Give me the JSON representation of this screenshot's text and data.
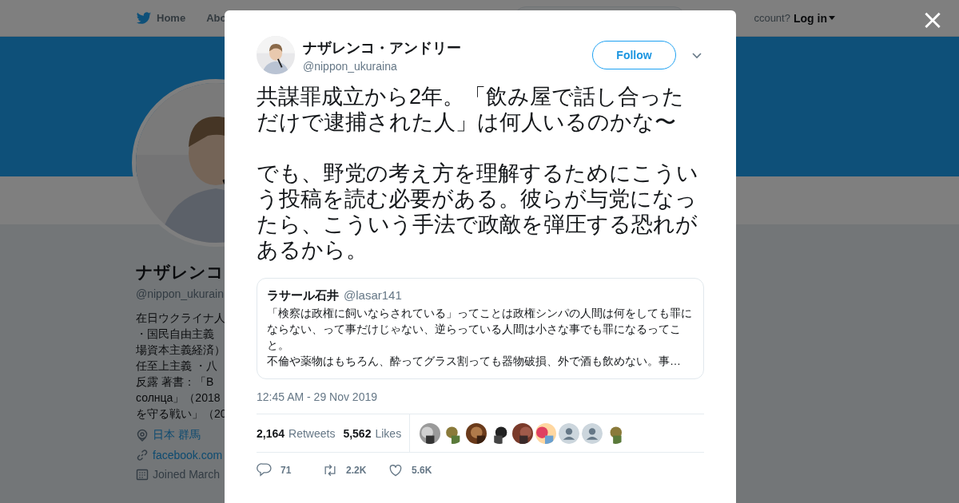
{
  "background_page": {
    "nav": {
      "items": [
        {
          "kind": "home",
          "label": "Home"
        },
        {
          "kind": "text",
          "label": "Abo"
        }
      ],
      "account_prompt": "ccount?",
      "login": "Log in"
    },
    "profile": {
      "avatar": {
        "kind": "picture"
      },
      "name": "ナザレンコ",
      "handle": "@nippon_ukurain",
      "bio_lines": [
        "在日ウクライナ人",
        "・国民自由主義",
        "場資本主義経済）",
        "任至上主義 ・八",
        "反露 著書：「В",
        "солнца」（2018",
        "を守る戦い」（20"
      ],
      "details": [
        {
          "kind": "location",
          "text": "日本 群馬"
        },
        {
          "kind": "link",
          "text": "facebook.com"
        },
        {
          "kind": "joined",
          "text": "Joined March"
        }
      ]
    }
  },
  "close_label": "×",
  "tweet": {
    "author": {
      "avatar": {
        "kind": "picture"
      },
      "name": "ナザレンコ・アンドリー",
      "handle": "@nippon_ukuraina"
    },
    "follow_button": "Follow",
    "paragraphs": [
      "共謀罪成立から2年。「飲み屋で話し合っただけで逮捕された人」は何人いるのかな〜",
      "でも、野党の考え方を理解するためにこういう投稿を読む必要がある。彼らが与党になったら、こういう手法で政敵を弾圧する恐れがあるから。"
    ],
    "quoted_tweet": {
      "name": "ラサール石井",
      "handle": "@lasar141",
      "lines": [
        "「検察は政権に飼いならされている」ってことは政権シンパの人間は何をしても罪にならない、って事だけじゃない、逆らっている人間は小さな事でも罪になるってこと。",
        "不倫や薬物はもちろん、酔ってグラス割っても器物破損、外で酒も飲めない。事…"
      ]
    },
    "timestamp": "12:45 AM - 29 Nov 2019",
    "stats": [
      {
        "count": "2,164",
        "label": "Retweets"
      },
      {
        "count": "5,562",
        "label": "Likes"
      }
    ],
    "liker_avatars": [
      {
        "kind": "picture"
      },
      {
        "kind": "picture"
      },
      {
        "kind": "picture"
      },
      {
        "kind": "picture"
      },
      {
        "kind": "picture"
      },
      {
        "kind": "picture"
      },
      {
        "kind": "default"
      },
      {
        "kind": "default"
      },
      {
        "kind": "picture"
      }
    ],
    "actions": [
      {
        "kind": "reply",
        "count": "71"
      },
      {
        "kind": "retweet",
        "count": "2.2K"
      },
      {
        "kind": "like",
        "count": "5.6K"
      }
    ]
  }
}
